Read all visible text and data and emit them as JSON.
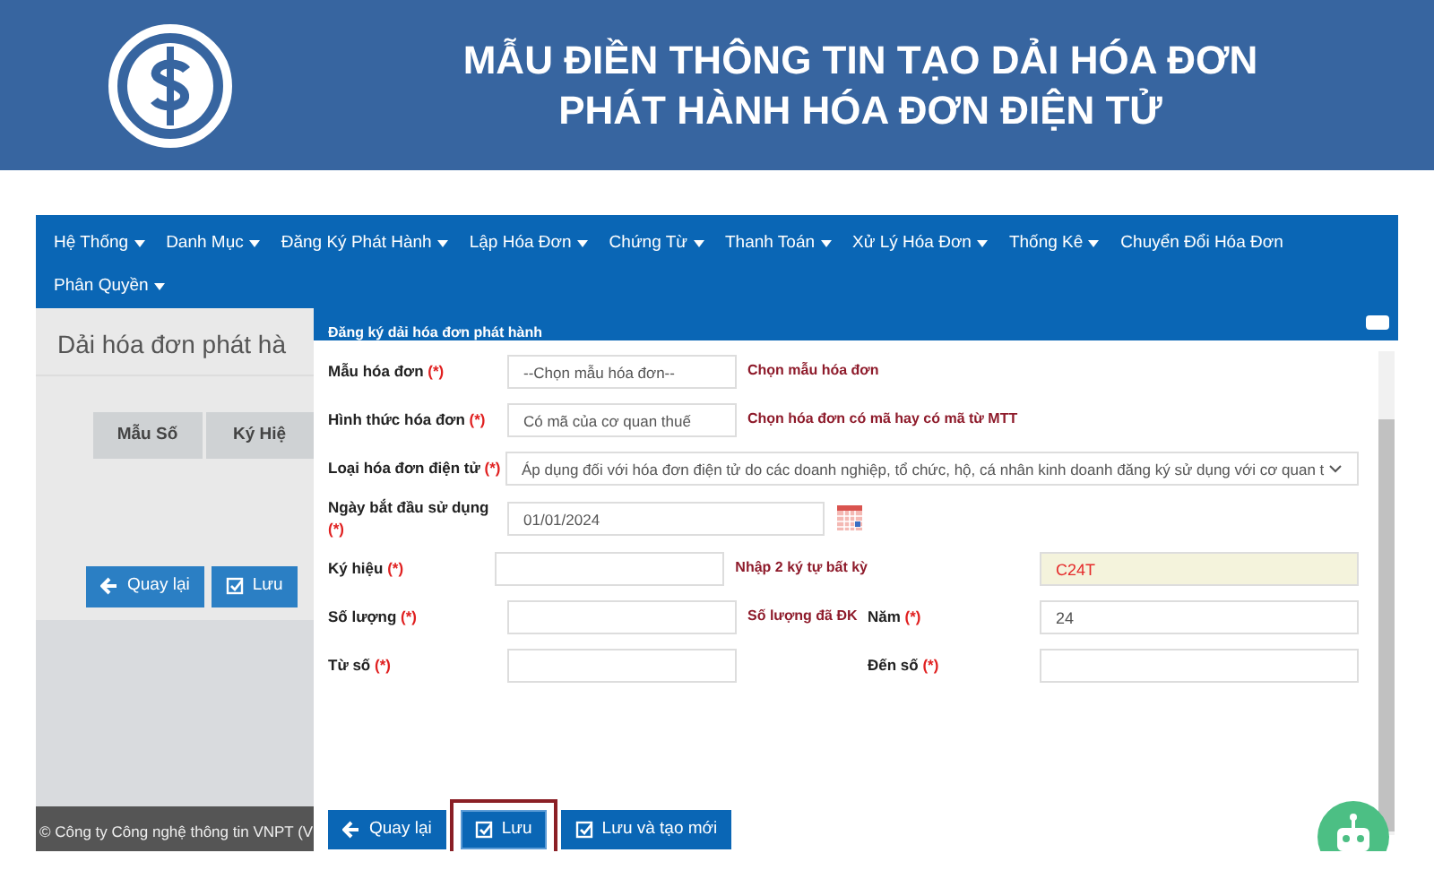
{
  "banner": {
    "title_lines": [
      "MẪU ĐIỀN THÔNG TIN TẠO DẢI HÓA ĐƠN",
      "PHÁT HÀNH HÓA ĐƠN ĐIỆN TỬ"
    ]
  },
  "navbar": {
    "items": [
      {
        "label": "Hệ Thống",
        "dropdown": true
      },
      {
        "label": "Danh Mục",
        "dropdown": true
      },
      {
        "label": "Đăng Ký Phát Hành",
        "dropdown": true
      },
      {
        "label": "Lập Hóa Đơn",
        "dropdown": true
      },
      {
        "label": "Chứng Từ",
        "dropdown": true
      },
      {
        "label": "Thanh Toán",
        "dropdown": true
      },
      {
        "label": "Xử Lý Hóa Đơn",
        "dropdown": true
      },
      {
        "label": "Thống Kê",
        "dropdown": true
      },
      {
        "label": "Chuyển Đổi Hóa Đơn",
        "dropdown": false
      },
      {
        "label": "Phân Quyền",
        "dropdown": true
      }
    ]
  },
  "background_page": {
    "title": "Dải hóa đơn phát hà",
    "table": {
      "columns": [
        "Mẫu Số",
        "Ký Hiệ"
      ]
    },
    "buttons": [
      {
        "label": "Quay lại",
        "kind": "back"
      },
      {
        "label": "Lưu",
        "kind": "save"
      }
    ],
    "footer": "© Công ty Công nghệ thông tin VNPT (V"
  },
  "modal": {
    "title": "Đăng ký dải hóa đơn phát hành",
    "rows": [
      {
        "label": "Mẫu hóa đơn",
        "required_mark": "(*)",
        "control": {
          "kind": "select",
          "value": "--Chọn mẫu hóa đơn--"
        },
        "hint": "Chọn mẫu hóa đơn"
      },
      {
        "label": "Hình thức hóa đơn",
        "required_mark": "(*)",
        "control": {
          "kind": "select",
          "value": "Có mã của cơ quan thuế"
        },
        "hint": "Chọn hóa đơn có mã hay có mã từ MTT"
      },
      {
        "label": "Loại hóa đơn điện tử",
        "required_mark": "(*)",
        "control": {
          "kind": "wide_select",
          "value": "Áp dụng đối với hóa đơn điện tử do các doanh nghiệp, tổ chức, hộ, cá nhân kinh doanh đăng ký sử dụng với cơ quan t"
        }
      },
      {
        "label": "Ngày bắt đầu sử dụng",
        "required_mark": "(*)",
        "control": {
          "kind": "date",
          "value": "01/01/2024"
        }
      },
      {
        "label": "Ký hiệu",
        "required_mark": "(*)",
        "control": {
          "kind": "text"
        },
        "hint": "Nhập 2 ký tự bất kỳ",
        "right": {
          "value": "C24T",
          "highlighted": true
        }
      },
      {
        "label": "Số lượng",
        "required_mark": "(*)",
        "control": {
          "kind": "text"
        },
        "hint": "Số lượng đã ĐK",
        "right": {
          "label": "Năm",
          "required_mark": "(*)",
          "value": "24",
          "highlighted": false
        }
      },
      {
        "label": "Từ số",
        "required_mark": "(*)",
        "control": {
          "kind": "text"
        },
        "right": {
          "label": "Đến số",
          "required_mark": "(*)",
          "highlighted": false
        }
      }
    ],
    "buttons": [
      {
        "label": "Quay lại",
        "kind": "back",
        "highlighted": false
      },
      {
        "label": "Lưu",
        "kind": "save",
        "highlighted": true
      },
      {
        "label": "Lưu và tạo mới",
        "kind": "save",
        "highlighted": false
      }
    ]
  }
}
